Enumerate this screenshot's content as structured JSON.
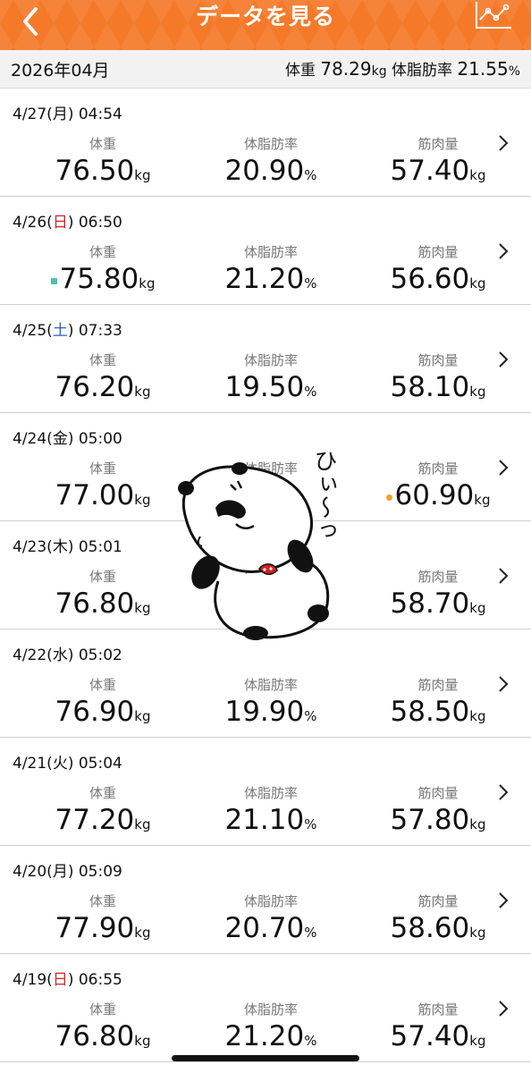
{
  "header": {
    "title": "データを見る",
    "back_icon": "chevron-left-icon",
    "graph_icon": "line-graph-icon",
    "color": "#f47a2a"
  },
  "summary": {
    "month": "2026年04月",
    "weight_label": "体重",
    "weight_value": "78.29",
    "weight_unit": "kg",
    "fat_label": "体脂肪率",
    "fat_value": "21.55",
    "fat_unit": "%"
  },
  "labels": {
    "weight": "体重",
    "fat": "体脂肪率",
    "muscle": "筋肉量"
  },
  "records": [
    {
      "date_pre": "4/27(",
      "day": "月",
      "date_post": ") 04:54",
      "day_color": "normal",
      "weight": "76.50",
      "weight_unit": "kg",
      "fat": "20.90",
      "fat_unit": "%",
      "muscle": "57.40",
      "muscle_unit": "kg",
      "weight_marker": "",
      "muscle_marker": ""
    },
    {
      "date_pre": "4/26(",
      "day": "日",
      "date_post": ") 06:50",
      "day_color": "red",
      "weight": "75.80",
      "weight_unit": "kg",
      "fat": "21.20",
      "fat_unit": "%",
      "muscle": "56.60",
      "muscle_unit": "kg",
      "weight_marker": "square",
      "muscle_marker": ""
    },
    {
      "date_pre": "4/25(",
      "day": "土",
      "date_post": ") 07:33",
      "day_color": "blue",
      "weight": "76.20",
      "weight_unit": "kg",
      "fat": "19.50",
      "fat_unit": "%",
      "muscle": "58.10",
      "muscle_unit": "kg",
      "weight_marker": "",
      "muscle_marker": ""
    },
    {
      "date_pre": "4/24(",
      "day": "金",
      "date_post": ") 05:00",
      "day_color": "normal",
      "weight": "77.00",
      "weight_unit": "kg",
      "fat": "",
      "fat_unit": "%",
      "muscle": "60.90",
      "muscle_unit": "kg",
      "weight_marker": "",
      "muscle_marker": "dot"
    },
    {
      "date_pre": "4/23(",
      "day": "木",
      "date_post": ") 05:01",
      "day_color": "normal",
      "weight": "76.80",
      "weight_unit": "kg",
      "fat": "",
      "fat_unit": "",
      "muscle": "58.70",
      "muscle_unit": "kg",
      "weight_marker": "",
      "muscle_marker": ""
    },
    {
      "date_pre": "4/22(",
      "day": "水",
      "date_post": ") 05:02",
      "day_color": "normal",
      "weight": "76.90",
      "weight_unit": "kg",
      "fat": "19.90",
      "fat_unit": "%",
      "muscle": "58.50",
      "muscle_unit": "kg",
      "weight_marker": "",
      "muscle_marker": ""
    },
    {
      "date_pre": "4/21(",
      "day": "火",
      "date_post": ") 05:04",
      "day_color": "normal",
      "weight": "77.20",
      "weight_unit": "kg",
      "fat": "21.10",
      "fat_unit": "%",
      "muscle": "57.80",
      "muscle_unit": "kg",
      "weight_marker": "",
      "muscle_marker": ""
    },
    {
      "date_pre": "4/20(",
      "day": "月",
      "date_post": ") 05:09",
      "day_color": "normal",
      "weight": "77.90",
      "weight_unit": "kg",
      "fat": "20.70",
      "fat_unit": "%",
      "muscle": "58.60",
      "muscle_unit": "kg",
      "weight_marker": "",
      "muscle_marker": ""
    },
    {
      "date_pre": "4/19(",
      "day": "日",
      "date_post": ") 06:55",
      "day_color": "red",
      "weight": "76.80",
      "weight_unit": "kg",
      "fat": "21.20",
      "fat_unit": "%",
      "muscle": "57.40",
      "muscle_unit": "kg",
      "weight_marker": "",
      "muscle_marker": ""
    }
  ],
  "sticker": {
    "text": "ひぃ〜っ",
    "icon": "panda-icon"
  }
}
